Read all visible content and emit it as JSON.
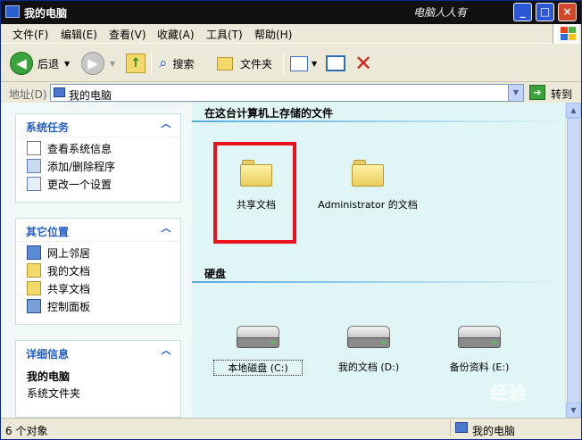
{
  "window": {
    "title": "我的电脑",
    "brand": "电脑人人有"
  },
  "menu": [
    "文件(F)",
    "编辑(E)",
    "查看(V)",
    "收藏(A)",
    "工具(T)",
    "帮助(H)"
  ],
  "toolbar": {
    "back": "后退",
    "search": "搜索",
    "folders": "文件夹"
  },
  "address": {
    "label": "地址(D)",
    "value": "我的电脑",
    "go": "转到"
  },
  "tasks": {
    "system": {
      "title": "系统任务",
      "items": [
        "查看系统信息",
        "添加/删除程序",
        "更改一个设置"
      ]
    },
    "places": {
      "title": "其它位置",
      "items": [
        "网上邻居",
        "我的文档",
        "共享文档",
        "控制面板"
      ]
    },
    "details": {
      "title": "详细信息",
      "name": "我的电脑",
      "type": "系统文件夹"
    }
  },
  "sections": {
    "stored": "在这台计算机上存储的文件",
    "drives": "硬盘"
  },
  "folders": [
    "共享文档",
    "Administrator 的文档"
  ],
  "drives": [
    "本地磁盘 (C:)",
    "我的文档 (D:)",
    "备份资料 (E:)"
  ],
  "status": {
    "count": "6 个对象",
    "location": "我的电脑"
  },
  "watermark": "经验",
  "colors": {
    "highlight": "#e8111d",
    "link": "#215dc6",
    "pane": "#e0f5f5"
  }
}
